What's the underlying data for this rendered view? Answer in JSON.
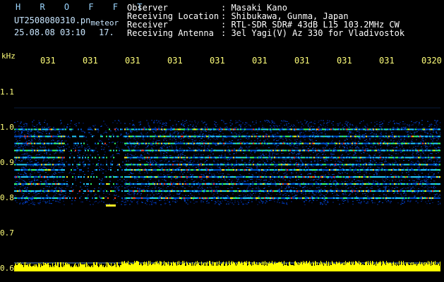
{
  "header": {
    "app_name": "H R O F F T",
    "filename": "UT2508080310.pn",
    "filename_suffix": "meteor",
    "datetime": "25.08.08 03:10",
    "extra": "17.",
    "fields": [
      {
        "key": "Observer",
        "value": ": Masaki Kano"
      },
      {
        "key": "Receiving Location",
        "value": ": Shibukawa, Gunma, Japan"
      },
      {
        "key": "Receiver",
        "value": ": RTL-SDR SDR# 43dB L15 103.2MHz CW"
      },
      {
        "key": "Receiving Antenna",
        "value": ": 3el Yagi(V) Az 330 for Vladivostok"
      }
    ]
  },
  "time_ticks": [
    "031",
    "031",
    "031",
    "031",
    "031",
    "031",
    "031",
    "031",
    "031",
    "0320"
  ],
  "freq_axis": {
    "unit": "kHz",
    "labels": [
      "1.1",
      "1.0",
      "0.9",
      "0.8",
      "0.7",
      "0.6"
    ]
  },
  "colors": {
    "background": "#000000",
    "header_text": "#ffffff",
    "axis_text": "#ffff7a",
    "trace": "#ffff00"
  },
  "chart_data": {
    "type": "heatmap",
    "ylabel": "kHz",
    "ylim": [
      0.6,
      1.1
    ],
    "bands_khz": [
      0.995,
      0.975,
      0.955,
      0.935,
      0.915,
      0.895,
      0.88,
      0.86,
      0.84,
      0.82,
      0.8
    ],
    "noise_band_khz": [
      0.78,
      1.02
    ]
  }
}
